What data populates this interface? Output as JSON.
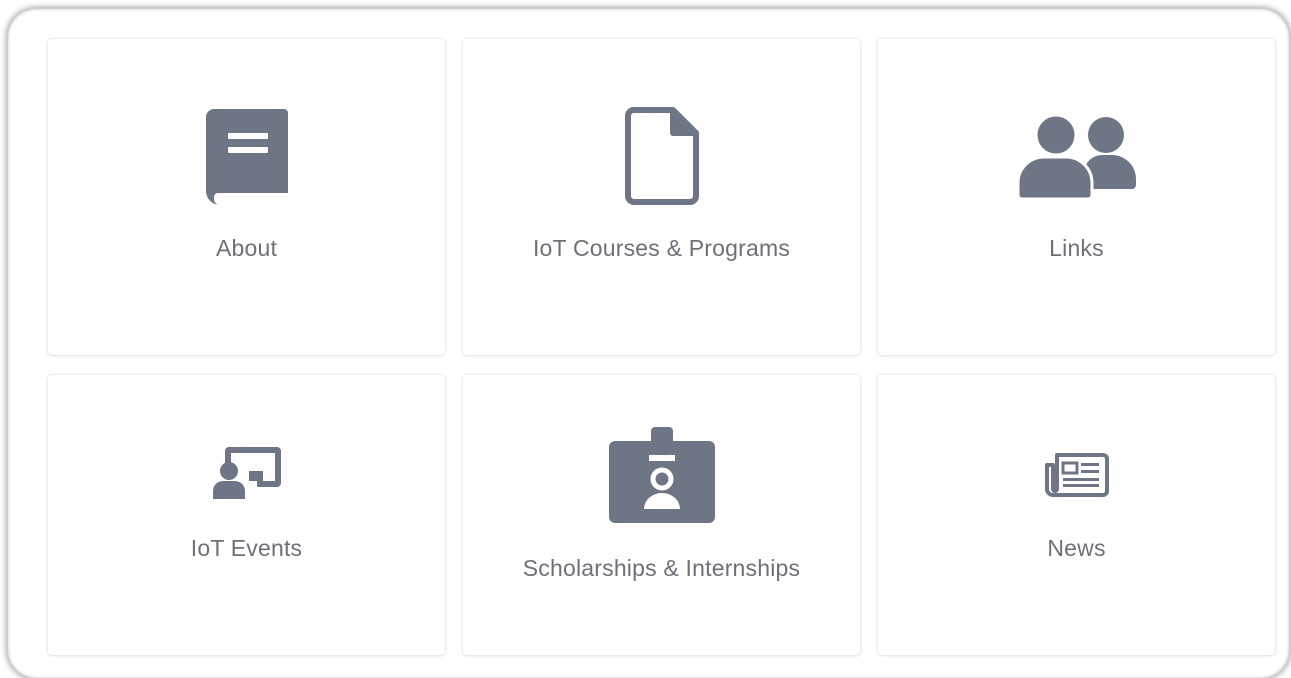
{
  "theme": {
    "icon_color": "#6e7686",
    "label_color": "#6d7079"
  },
  "tiles": [
    {
      "label": "About",
      "icon": "book-icon"
    },
    {
      "label": "IoT Courses & Programs",
      "icon": "file-icon"
    },
    {
      "label": "Links",
      "icon": "users-icon"
    },
    {
      "label": "IoT Events",
      "icon": "presentation-icon"
    },
    {
      "label": "Scholarships & Internships",
      "icon": "id-badge-icon"
    },
    {
      "label": "News",
      "icon": "newspaper-icon"
    }
  ]
}
